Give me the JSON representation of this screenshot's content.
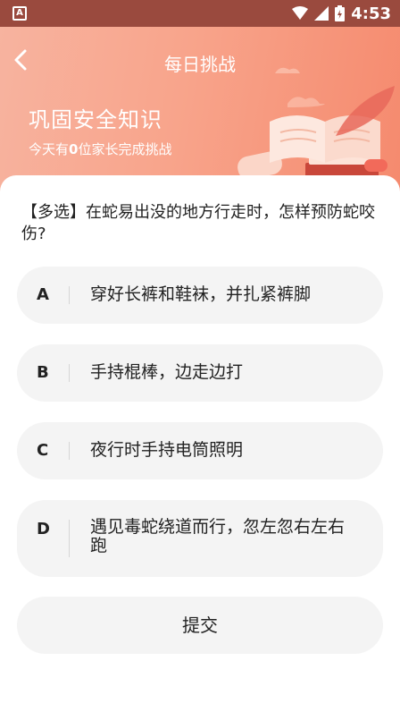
{
  "status_bar": {
    "time": "4:53",
    "app_icon_letter": "A"
  },
  "header": {
    "title": "每日挑战",
    "banner_heading": "巩固安全知识",
    "banner_sub_prefix": "今天有",
    "banner_sub_count": "0",
    "banner_sub_suffix": "位家长完成挑战"
  },
  "question": {
    "text": "【多选】在蛇易出没的地方行走时，怎样预防蛇咬伤?"
  },
  "options": [
    {
      "letter": "A",
      "text": "穿好长裤和鞋袜，并扎紧裤脚"
    },
    {
      "letter": "B",
      "text": "手持棍棒，边走边打"
    },
    {
      "letter": "C",
      "text": "夜行时手持电筒照明"
    },
    {
      "letter": "D",
      "text": "遇见毒蛇绕道而行，忽左忽右左右跑"
    }
  ],
  "submit": {
    "label": "提交"
  },
  "colors": {
    "status_bar": "#9a4a3e",
    "header_start": "#f7b39f",
    "header_end": "#f58a6e",
    "option_bg": "#f4f4f4"
  }
}
